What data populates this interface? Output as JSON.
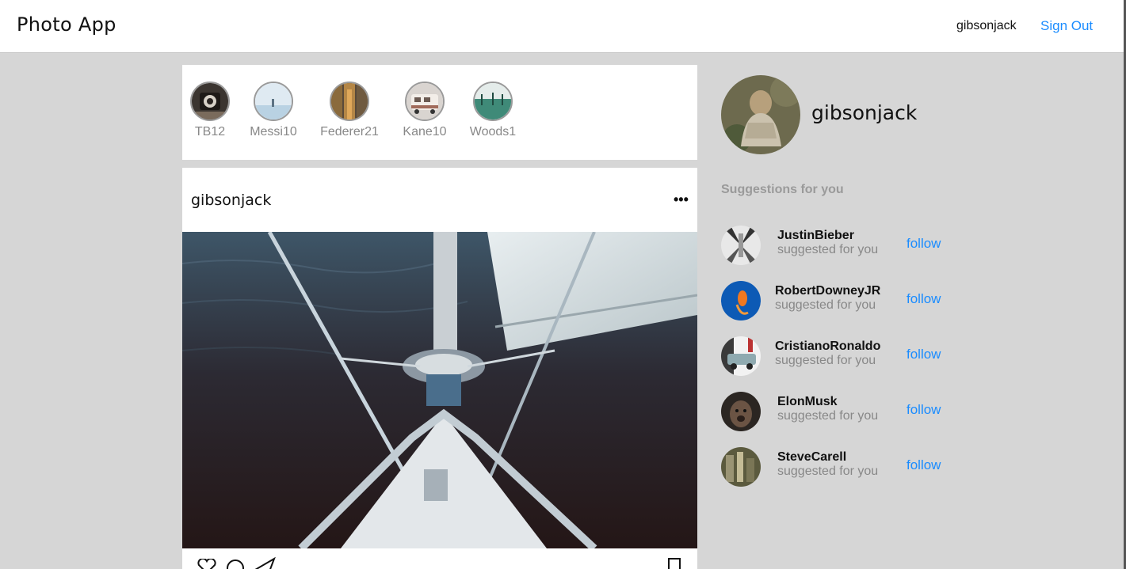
{
  "header": {
    "brand": "Photo App",
    "username": "gibsonjack",
    "signout_label": "Sign Out"
  },
  "stories": [
    {
      "label": "TB12"
    },
    {
      "label": "Messi10"
    },
    {
      "label": "Federer21"
    },
    {
      "label": "Kane10"
    },
    {
      "label": "Woods1"
    }
  ],
  "post": {
    "username": "gibsonjack",
    "more_label": "•••"
  },
  "profile": {
    "username": "gibsonjack"
  },
  "suggestions": {
    "heading": "Suggestions for you",
    "follow_label": "follow",
    "items": [
      {
        "name": "JustinBieber",
        "subtitle": "suggested for you"
      },
      {
        "name": "RobertDowneyJR",
        "subtitle": "suggested for you"
      },
      {
        "name": "CristianoRonaldo",
        "subtitle": "suggested for you"
      },
      {
        "name": "ElonMusk",
        "subtitle": "suggested for you"
      },
      {
        "name": "SteveCarell",
        "subtitle": "suggested for you"
      }
    ]
  },
  "colors": {
    "accent": "#1a8cff",
    "page_background": "#d6d6d6",
    "muted_text": "#888888"
  }
}
